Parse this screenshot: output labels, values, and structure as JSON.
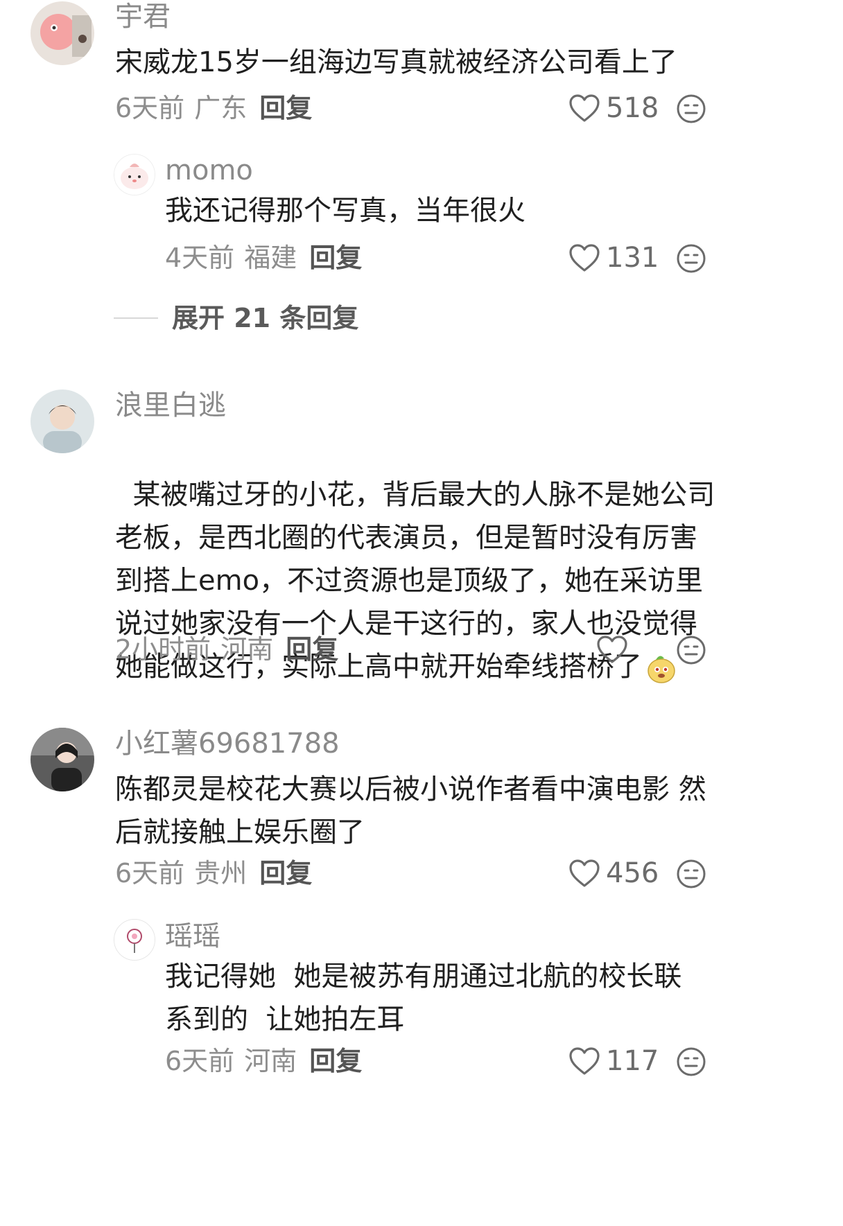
{
  "comments": [
    {
      "user": "宇君",
      "text": "宋威龙15岁一组海边写真就被经济公司看上了",
      "time": "6天前",
      "location": "广东",
      "reply_label": "回复",
      "likes": "518"
    },
    {
      "user": "momo",
      "text": "我还记得那个写真，当年很火",
      "time": "4天前",
      "location": "福建",
      "reply_label": "回复",
      "likes": "131"
    },
    {
      "user": "浪里白逃",
      "text": "某被嘴过牙的小花，背后最大的人脉不是她公司\n老板，是西北圈的代表演员，但是暂时没有厉害\n到搭上emo，不过资源也是顶级了，她在采访里\n说过她家没有一个人是干这行的，家人也没觉得\n她能做这行，实际上高中就开始牵线搭桥了",
      "time": "2小时前",
      "location": "河南",
      "reply_label": "回复",
      "likes": ""
    },
    {
      "user": "小红薯69681788",
      "text": "陈都灵是校花大赛以后被小说作者看中演电影 然\n后就接触上娱乐圈了",
      "time": "6天前",
      "location": "贵州",
      "reply_label": "回复",
      "likes": "456"
    },
    {
      "user": "瑶瑶",
      "text": "我记得她  她是被苏有朋通过北航的校长联\n系到的  让她拍左耳",
      "time": "6天前",
      "location": "河南",
      "reply_label": "回复",
      "likes": "117"
    }
  ],
  "expand_replies": "展开 21 条回复",
  "icons": {
    "like": "heart-icon",
    "dislike": "meh-face-icon",
    "emoji": "puppy-emoji-icon"
  }
}
